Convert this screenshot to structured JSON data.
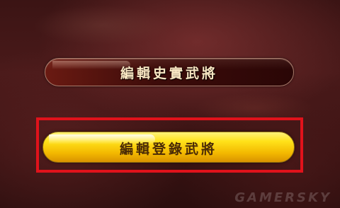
{
  "menu": {
    "items": [
      {
        "label": "編輯史實武將"
      },
      {
        "label": "編輯登錄武將",
        "selected": true
      }
    ]
  },
  "watermark": "GAMERSKY",
  "colors": {
    "highlight_frame": "#e0121b",
    "selected_button": "#ffe21a",
    "button_dark": "#3d0c0a"
  }
}
